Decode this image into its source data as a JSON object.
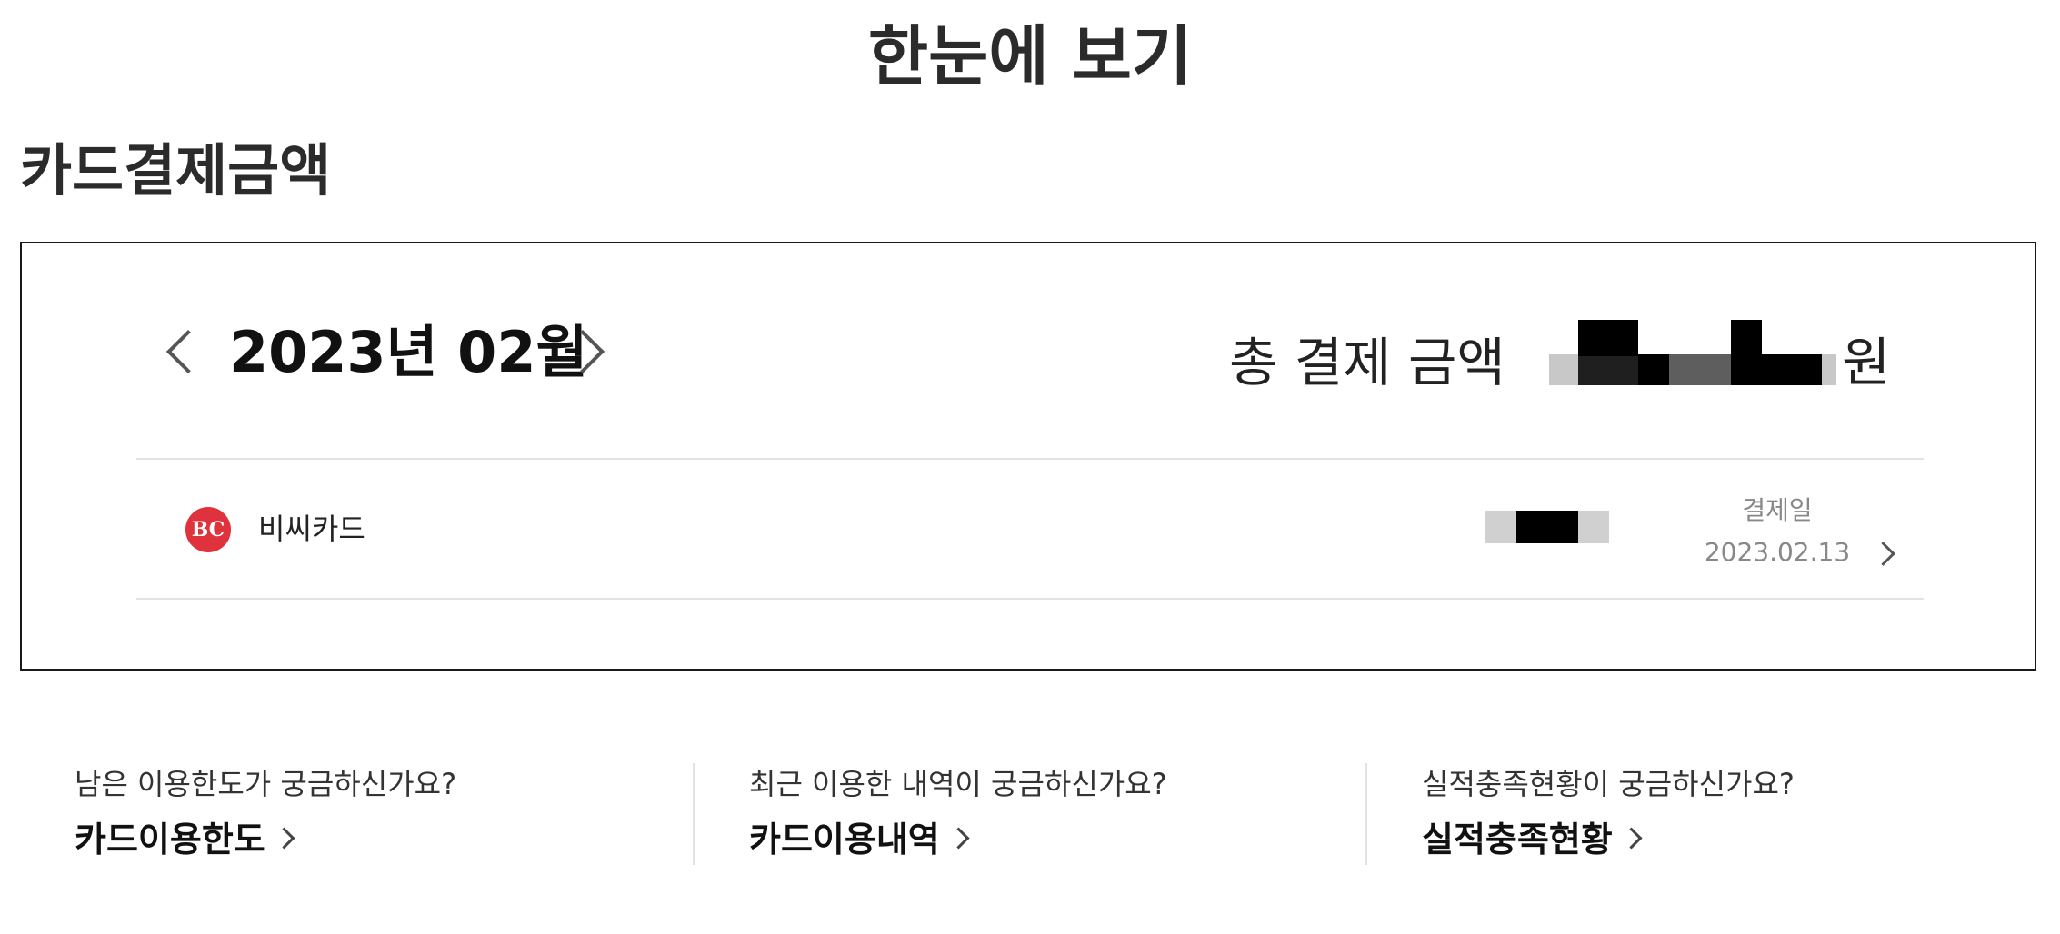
{
  "page": {
    "title": "한눈에 보기"
  },
  "section": {
    "title": "카드결제금액"
  },
  "summary": {
    "month": "2023년 02월",
    "total_label": "총 결제 금액",
    "currency": "원",
    "amount_masked": true
  },
  "cards": [
    {
      "logo_text": "BC",
      "name": "비씨카드",
      "amount_masked": true,
      "pay_date_label": "결제일",
      "pay_date": "2023.02.13"
    }
  ],
  "links": [
    {
      "question": "남은 이용한도가 궁금하신가요?",
      "action": "카드이용한도"
    },
    {
      "question": "최근 이용한 내역이 궁금하신가요?",
      "action": "카드이용내역"
    },
    {
      "question": "실적충족현황이 궁금하신가요?",
      "action": "실적충족현황"
    }
  ],
  "colors": {
    "bc_logo": "#e0323c",
    "divider": "#e3e3e3",
    "box_border": "#1a1a1a"
  }
}
